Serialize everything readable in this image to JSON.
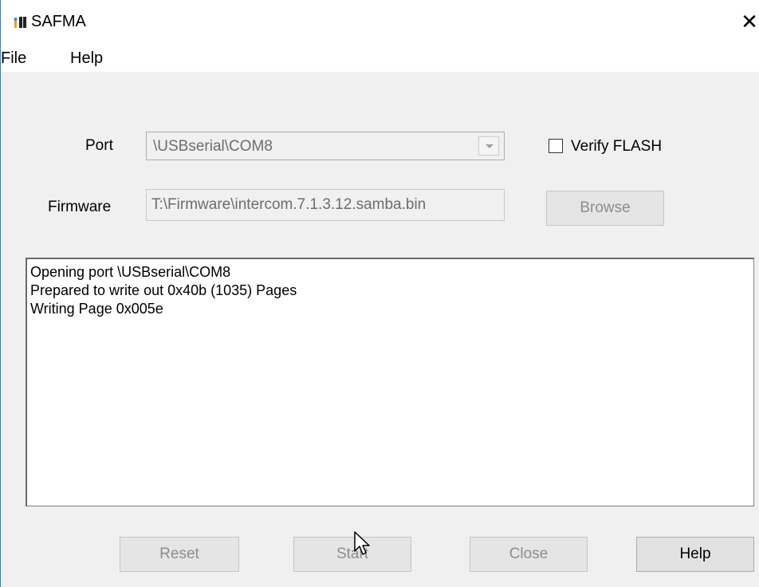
{
  "window": {
    "title": "SAFMA",
    "close_glyph": "✕",
    "icon": "app-icon"
  },
  "menu": {
    "items": [
      {
        "label": "File"
      },
      {
        "label": "Help"
      }
    ]
  },
  "form": {
    "port_label": "Port",
    "port_value": "\\USBserial\\COM8",
    "firmware_label": "Firmware",
    "firmware_value": "T:\\Firmware\\intercom.7.1.3.12.samba.bin",
    "verify_label": "Verify FLASH",
    "verify_checked": false,
    "browse_label": "Browse"
  },
  "log": {
    "lines": [
      "Opening port \\USBserial\\COM8",
      "Prepared to write out 0x40b (1035) Pages",
      "Writing Page 0x005e"
    ]
  },
  "buttons": {
    "reset_label": "Reset",
    "start_label": "Start",
    "close_label": "Close",
    "help_label": "Help"
  },
  "colors": {
    "window_bg": "#f0f0f0",
    "titlebar_bg": "#ffffff",
    "disabled_text": "#8d8d8d"
  }
}
